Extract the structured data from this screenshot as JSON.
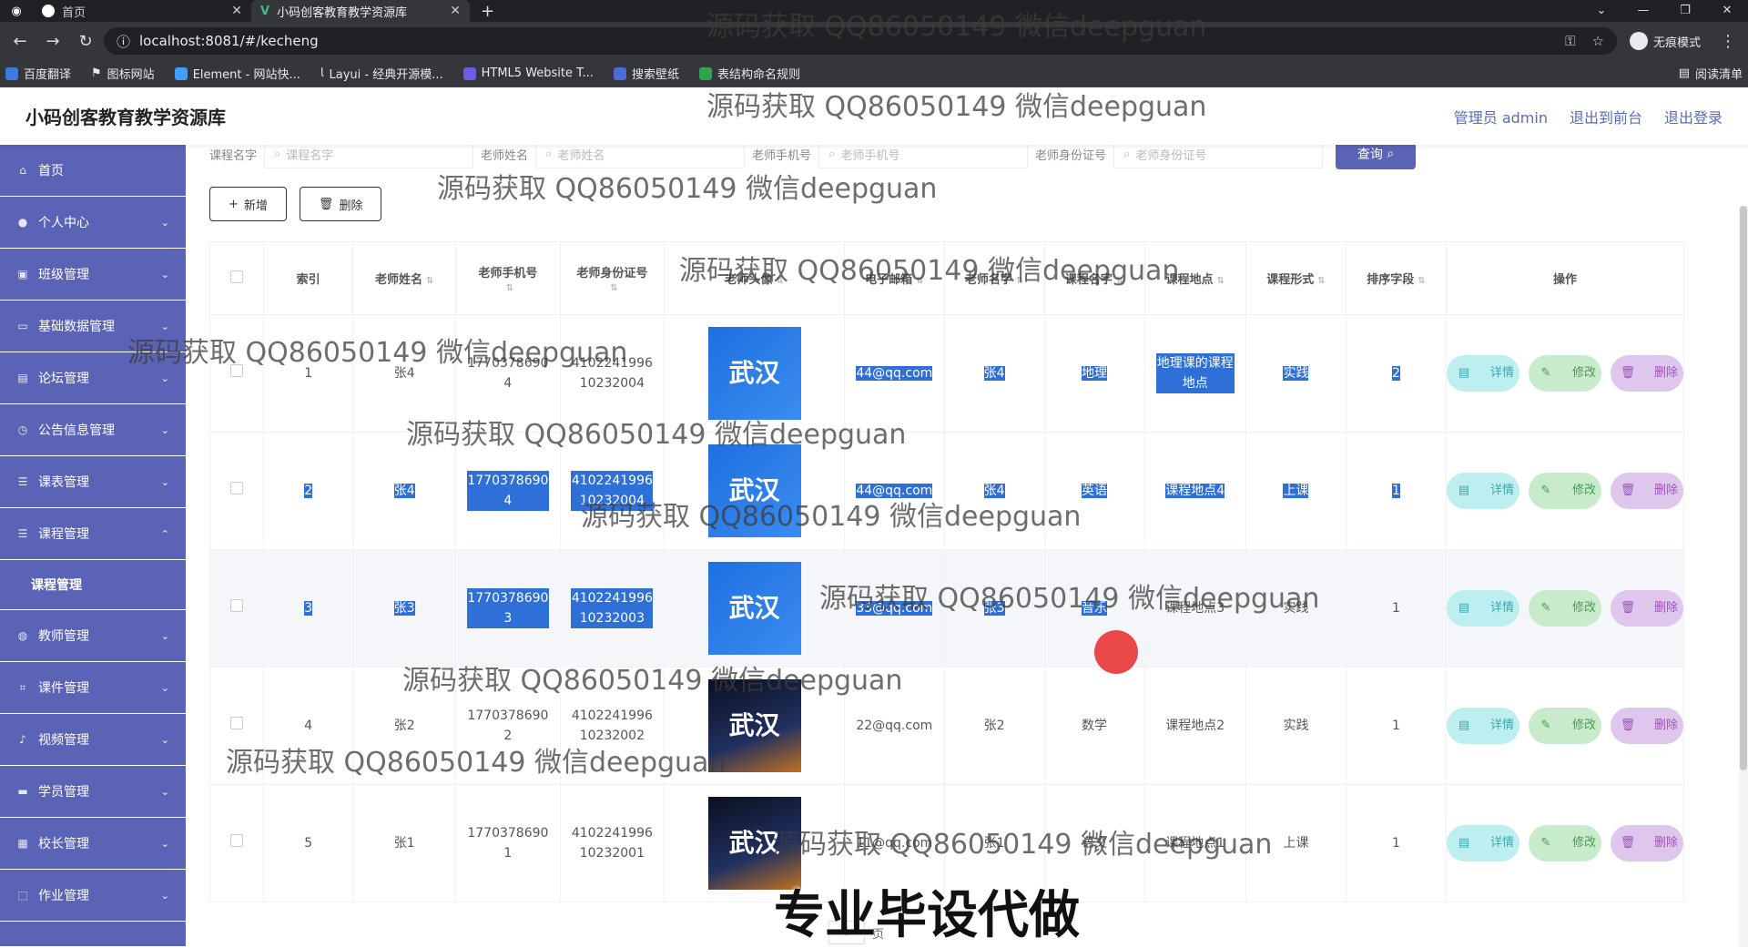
{
  "browser": {
    "tabs": [
      {
        "title": "首页",
        "active": false
      },
      {
        "title": "小码创客教育教学资源库",
        "active": true
      }
    ],
    "url": "localhost:8081/#/kecheng",
    "incognito_label": "无痕模式",
    "bookmarks": [
      "百度翻译",
      "图标网站",
      "Element - 网站快...",
      "Layui - 经典开源模...",
      "HTML5 Website T...",
      "搜索壁纸",
      "表结构命名规则"
    ],
    "reading_list": "阅读清单"
  },
  "header": {
    "title": "小码创客教育教学资源库",
    "links": [
      "管理员 admin",
      "退出到前台",
      "退出登录"
    ]
  },
  "sidebar": {
    "items": [
      {
        "label": "首页",
        "icon": "home-icon",
        "expandable": false
      },
      {
        "label": "个人中心",
        "icon": "user-icon",
        "expandable": true
      },
      {
        "label": "班级管理",
        "icon": "class-icon",
        "expandable": true
      },
      {
        "label": "基础数据管理",
        "icon": "data-icon",
        "expandable": true
      },
      {
        "label": "论坛管理",
        "icon": "forum-icon",
        "expandable": true
      },
      {
        "label": "公告信息管理",
        "icon": "clock-icon",
        "expandable": true
      },
      {
        "label": "课表管理",
        "icon": "list-icon",
        "expandable": true
      },
      {
        "label": "课程管理",
        "icon": "list-icon",
        "expandable": true,
        "open": true
      }
    ],
    "submenu": "课程管理",
    "items2": [
      {
        "label": "教师管理",
        "icon": "globe-icon"
      },
      {
        "label": "课件管理",
        "icon": "crop-icon"
      },
      {
        "label": "视频管理",
        "icon": "mic-icon"
      },
      {
        "label": "学员管理",
        "icon": "card-icon"
      },
      {
        "label": "校长管理",
        "icon": "grid-icon"
      },
      {
        "label": "作业管理",
        "icon": "frame-icon"
      }
    ]
  },
  "search": {
    "fields": [
      {
        "label": "课程名字",
        "placeholder": "课程名字"
      },
      {
        "label": "老师姓名",
        "placeholder": "老师姓名"
      },
      {
        "label": "老师手机号",
        "placeholder": "老师手机号"
      },
      {
        "label": "老师身份证号",
        "placeholder": "老师身份证号"
      }
    ],
    "query_label": "查询"
  },
  "toolbar": {
    "add_label": "新增",
    "delete_label": "删除"
  },
  "table": {
    "headers": [
      "索引",
      "老师姓名",
      "老师手机号",
      "老师身份证号",
      "老师头像",
      "电子邮箱",
      "老师名字",
      "课程名字",
      "课程地点",
      "课程形式",
      "排序字段",
      "操作"
    ],
    "rows": [
      {
        "idx": "1",
        "tname": "张4",
        "phone": "17703786904",
        "idcard": "410224199610232004",
        "email": "44@qq.com",
        "tname2": "张4",
        "course": "地理",
        "place": "地理课的课程地点",
        "form": "实践",
        "sort": "2"
      },
      {
        "idx": "2",
        "tname": "张4",
        "phone": "17703786904",
        "idcard": "410224199610232004",
        "email": "44@qq.com",
        "tname2": "张4",
        "course": "英语",
        "place": "课程地点4",
        "form": "上课",
        "sort": "1"
      },
      {
        "idx": "3",
        "tname": "张3",
        "phone": "17703786903",
        "idcard": "410224199610232003",
        "email": "33@qq.com",
        "tname2": "张3",
        "course": "音乐",
        "place": "课程地点3",
        "form": "实践",
        "sort": "1"
      },
      {
        "idx": "4",
        "tname": "张2",
        "phone": "17703786902",
        "idcard": "410224199610232002",
        "email": "22@qq.com",
        "tname2": "张2",
        "course": "数学",
        "place": "课程地点2",
        "form": "实践",
        "sort": "1"
      },
      {
        "idx": "5",
        "tname": "张1",
        "phone": "17703786901",
        "idcard": "410224199610232001",
        "email": "11@qq.com",
        "tname2": "张1",
        "course": "语文",
        "place": "课程地点1",
        "form": "上课",
        "sort": "1"
      }
    ],
    "actions": {
      "detail": "详情",
      "edit": "修改",
      "remove": "删除"
    }
  },
  "pager": {
    "page": "1",
    "suffix": "页"
  },
  "watermark": "源码获取 QQ86050149 微信deepguan",
  "promo": "专业毕设代做",
  "colors": {
    "sidebar": "#5b63b7",
    "header_link": "#5a6bb8",
    "highlight": "#2f6fd8"
  }
}
